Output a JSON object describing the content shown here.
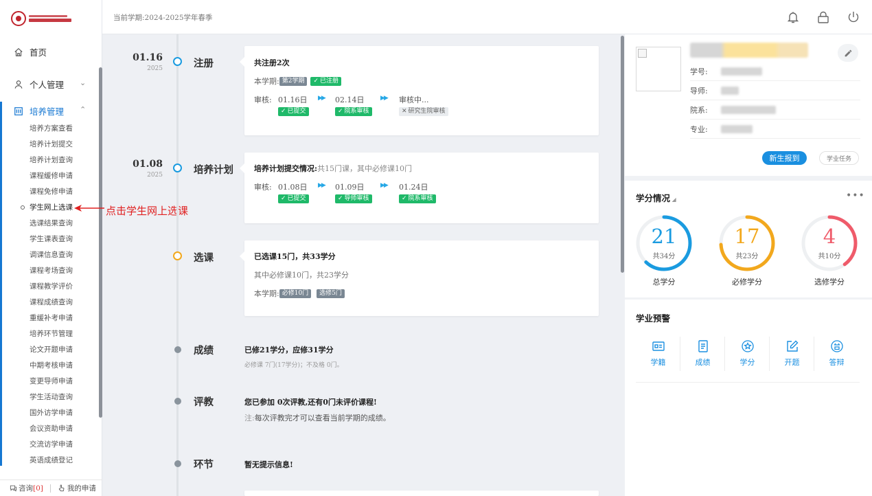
{
  "header": {
    "term": "当前学期:2024-2025学年春季"
  },
  "sidebar": {
    "home": "首页",
    "personal": "个人管理",
    "training": "培养管理",
    "sub_items": [
      "培养方案查看",
      "培养计划提交",
      "培养计划查询",
      "课程缓修申请",
      "课程免修申请",
      "学生网上选课",
      "选课结果查询",
      "学生课表查询",
      "调课信息查询",
      "课程考场查询",
      "课程教学评价",
      "课程成绩查询",
      "重缓补考申请",
      "培养环节管理",
      "论文开题申请",
      "中期考核申请",
      "变更导师申请",
      "学生活动查询",
      "国外访学申请",
      "会议资助申请",
      "交流访学申请",
      "英语成绩登记"
    ],
    "footer": {
      "consult": "咨询",
      "consult_count": "[0]",
      "my_apply": "我的申请"
    }
  },
  "annotation": "点击学生网上选课",
  "timeline": {
    "register": {
      "date": "01.16",
      "year": "2025",
      "label": "注册",
      "title": "共注册2次",
      "term_label": "本学期:",
      "term_tag": "第2学期",
      "status_tag": "已注册",
      "review_label": "审核:",
      "steps": [
        {
          "date": "01.16日",
          "tag": "已提交"
        },
        {
          "date": "02.14日",
          "tag": "院系审核"
        },
        {
          "date": "审核中...",
          "tag": "研究生院审核"
        }
      ]
    },
    "plan": {
      "date": "01.08",
      "year": "2025",
      "label": "培养计划",
      "title": "培养计划提交情况:",
      "title_detail": "共15门课，其中必修课10门",
      "review_label": "审核:",
      "steps": [
        {
          "date": "01.08日",
          "tag": "已提交"
        },
        {
          "date": "01.09日",
          "tag": "导师审核"
        },
        {
          "date": "01.24日",
          "tag": "院系审核"
        }
      ]
    },
    "course": {
      "label": "选课",
      "title": "已选课15门，共33学分",
      "line2": "其中必修课10门，共23学分",
      "term_label": "本学期:",
      "tag1": "必修10门",
      "tag2": "选修5门"
    },
    "grade": {
      "label": "成绩",
      "title": "已修21学分，应修31学分",
      "sub": "必修课 7门(17学分)；不及格 0门。"
    },
    "eval": {
      "label": "评教",
      "title": "您已参加 0次评教,还有0门未评价课程!",
      "note_prefix": "注:",
      "note": "每次评教完才可以查看当前学期的成绩。"
    },
    "link": {
      "label": "环节",
      "title": "暂无提示信息!"
    }
  },
  "profile": {
    "student_id_label": "学号:",
    "advisor_label": "导师:",
    "dept_label": "院系:",
    "major_label": "专业:",
    "btn_report": "新生报到",
    "btn_task": "学业任务"
  },
  "credits": {
    "title": "学分情况",
    "gauges": [
      {
        "value": "21",
        "total": "共34分",
        "caption": "总学分",
        "ratio": 0.62,
        "color": "#1a9be0"
      },
      {
        "value": "17",
        "total": "共23分",
        "caption": "必修学分",
        "ratio": 0.74,
        "color": "#f2a81d"
      },
      {
        "value": "4",
        "total": "共10分",
        "caption": "选修学分",
        "ratio": 0.4,
        "color": "#ef5b6a"
      }
    ]
  },
  "warning": {
    "title": "学业预警",
    "items": [
      "学籍",
      "成绩",
      "学分",
      "开题",
      "答辩"
    ]
  }
}
